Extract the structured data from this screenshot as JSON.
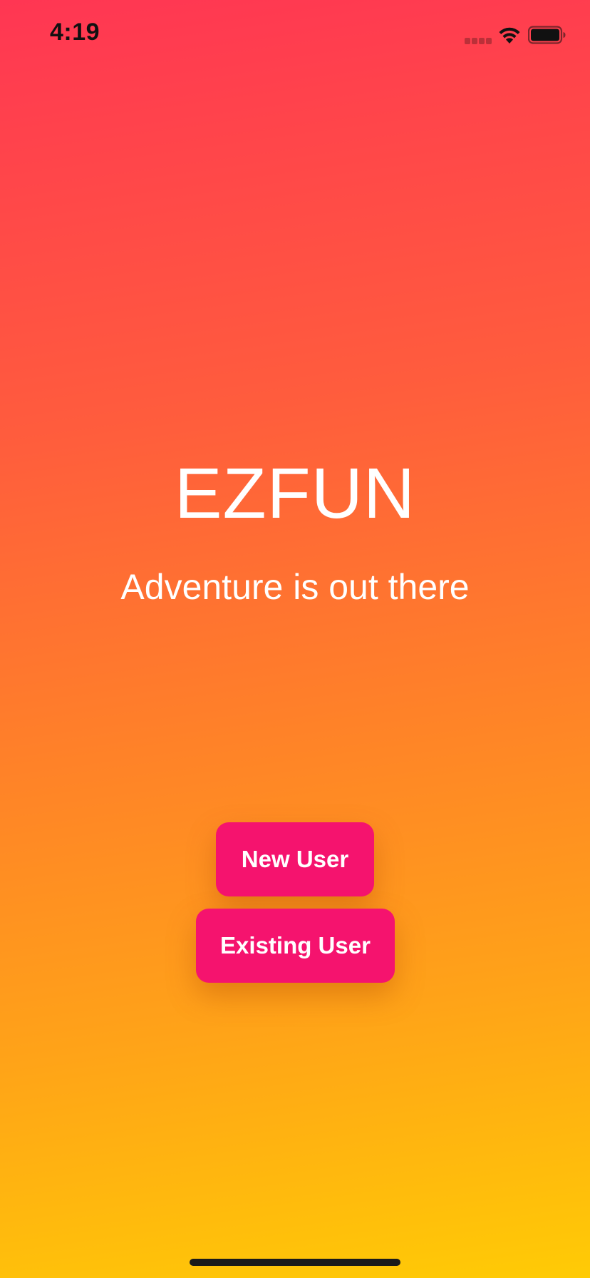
{
  "status_bar": {
    "time": "4:19",
    "icons": [
      "cellular-signal-icon",
      "wifi-icon",
      "battery-icon"
    ]
  },
  "main": {
    "title": "EZFUN",
    "tagline": "Adventure is out there"
  },
  "actions": {
    "new_user_label": "New User",
    "existing_user_label": "Existing User"
  },
  "colors": {
    "gradient_top": "#ff3653",
    "gradient_middle": "#ff8427",
    "gradient_bottom": "#ffcb05",
    "button_background": "#f5136e",
    "text": "#ffffff"
  }
}
